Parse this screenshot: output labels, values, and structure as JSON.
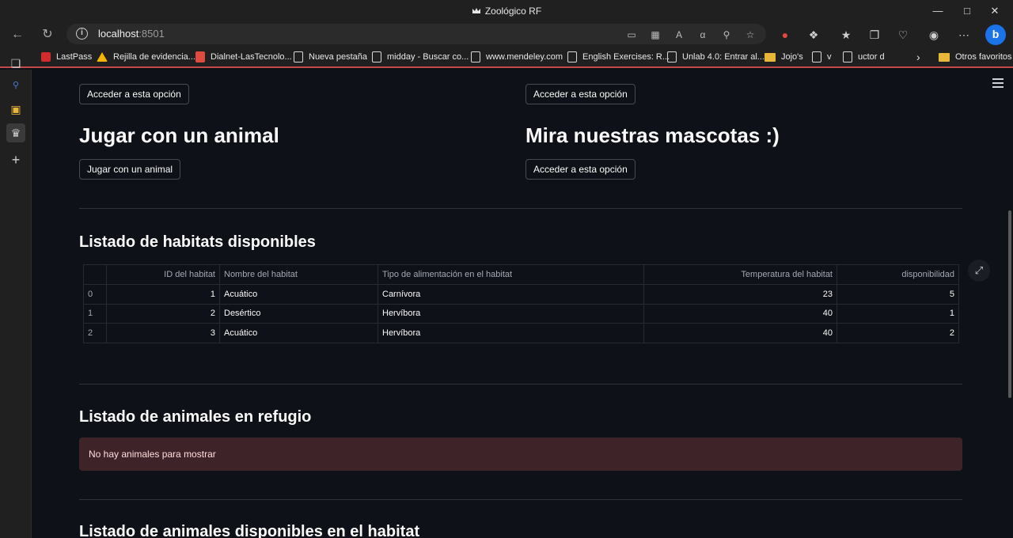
{
  "window": {
    "title": "Zoológico RF"
  },
  "address": {
    "host": "localhost",
    "port": ":8501"
  },
  "bookmarks": [
    "LastPass",
    "Rejilla de evidencia...",
    "Dialnet-LasTecnolo...",
    "Nueva pestaña",
    "midday - Buscar co...",
    "www.mendeley.com",
    "English Exercises: R...",
    "Unlab 4.0: Entrar al...",
    "Jojo's",
    "v",
    "uctor d"
  ],
  "bookmarks_other": "Otros favoritos",
  "sections": {
    "top_buttons": {
      "left": "Acceder a esta opción",
      "right": "Acceder a esta opción"
    },
    "play": {
      "title": "Jugar con un animal",
      "button": "Jugar con un animal"
    },
    "pets": {
      "title": "Mira nuestras mascotas :)",
      "button": "Acceder a esta opción"
    }
  },
  "habitats": {
    "title": "Listado de habitats disponibles",
    "columns": [
      "",
      "ID del habitat",
      "Nombre del habitat",
      "Tipo de alimentación en el habitat",
      "Temperatura del habitat",
      "disponibilidad"
    ],
    "rows": [
      [
        "0",
        "1",
        "Acuático",
        "Carnívora",
        "23",
        "5"
      ],
      [
        "1",
        "2",
        "Desértico",
        "Hervíbora",
        "40",
        "1"
      ],
      [
        "2",
        "3",
        "Acuático",
        "Hervíbora",
        "40",
        "2"
      ]
    ]
  },
  "refuge": {
    "title": "Listado de animales en refugio",
    "message": "No hay animales para mostrar"
  },
  "habitat_animals": {
    "title": "Listado de animales disponibles en el habitat"
  },
  "colors": {
    "background": "#0e1117",
    "alert_bg": "#3e2328",
    "accent_line": "#c44a4a"
  }
}
